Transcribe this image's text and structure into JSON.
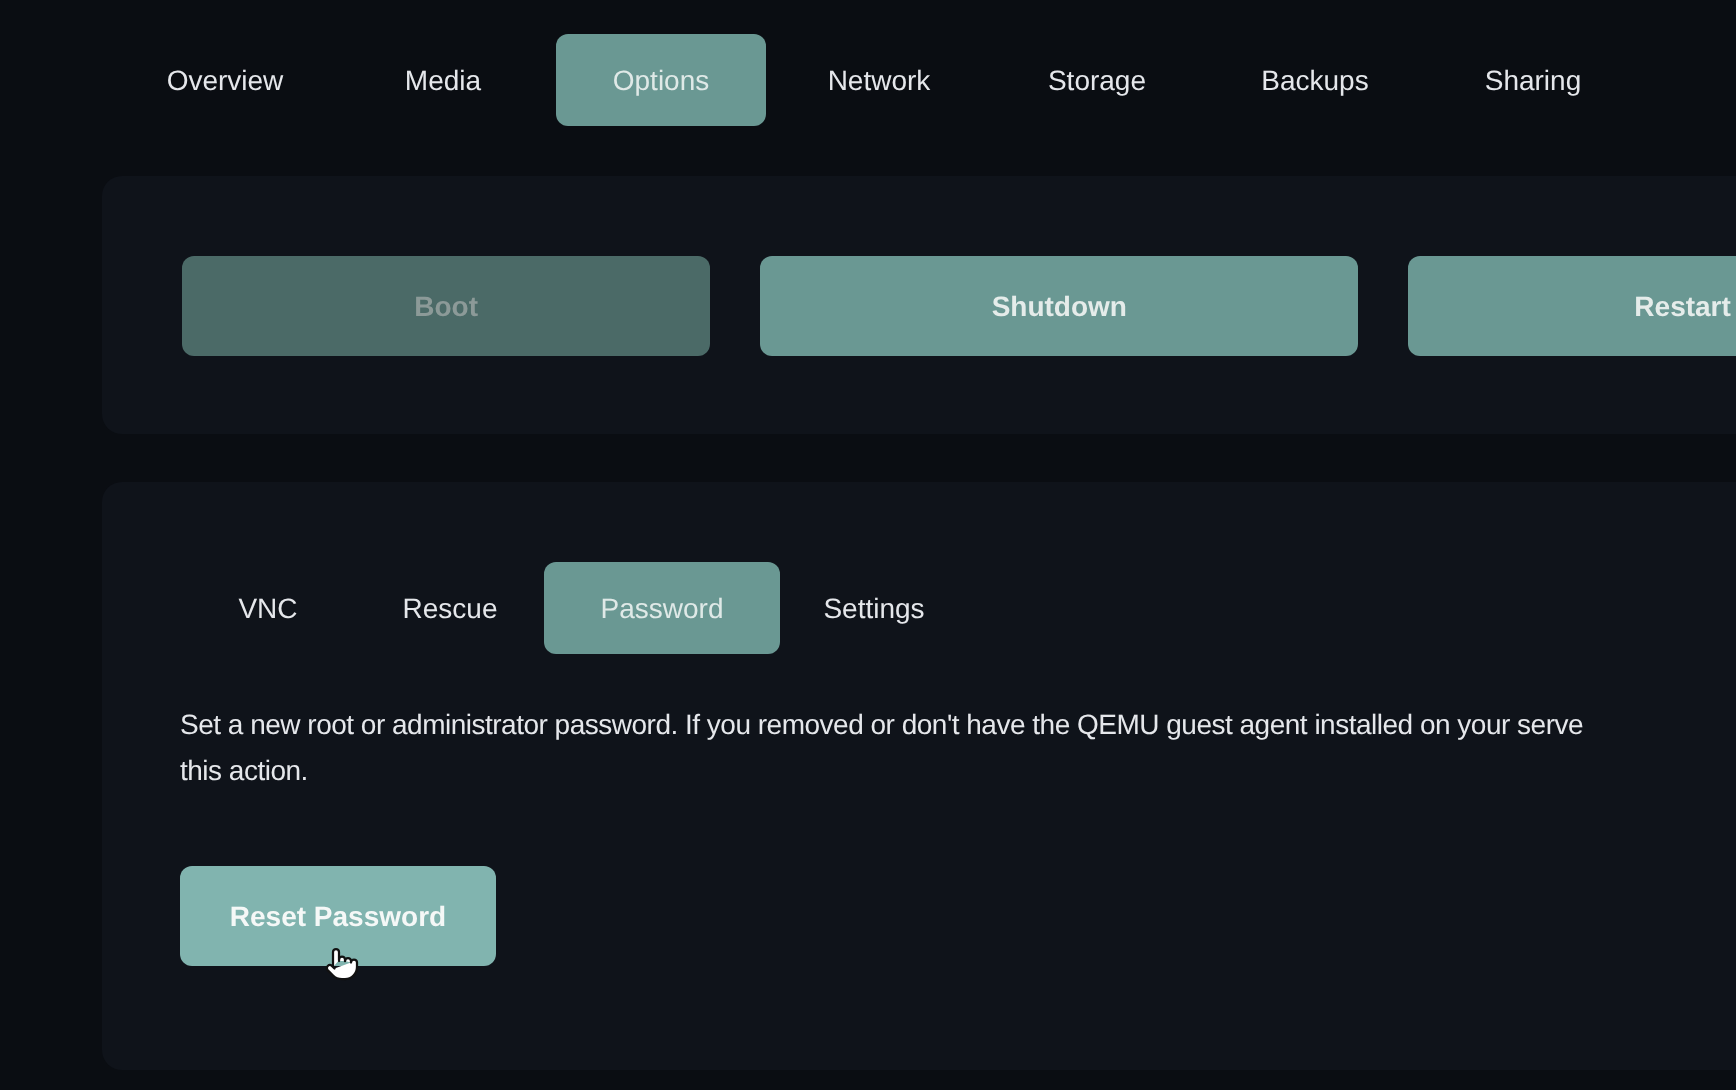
{
  "tabs": [
    {
      "label": "Overview",
      "selected": false
    },
    {
      "label": "Media",
      "selected": false
    },
    {
      "label": "Options",
      "selected": true
    },
    {
      "label": "Network",
      "selected": false
    },
    {
      "label": "Storage",
      "selected": false
    },
    {
      "label": "Backups",
      "selected": false
    },
    {
      "label": "Sharing",
      "selected": false
    }
  ],
  "power_buttons": [
    {
      "label": "Boot",
      "disabled": true
    },
    {
      "label": "Shutdown",
      "disabled": false
    },
    {
      "label": "Restart",
      "disabled": false
    }
  ],
  "subtabs": [
    {
      "label": "VNC",
      "selected": false
    },
    {
      "label": "Rescue",
      "selected": false
    },
    {
      "label": "Password",
      "selected": true
    },
    {
      "label": "Settings",
      "selected": false
    }
  ],
  "description_lines": [
    "Set a new root or administrator password. If you removed or don't have the QEMU guest agent installed on your serve",
    "this action."
  ],
  "reset_button": {
    "label": "Reset Password"
  }
}
